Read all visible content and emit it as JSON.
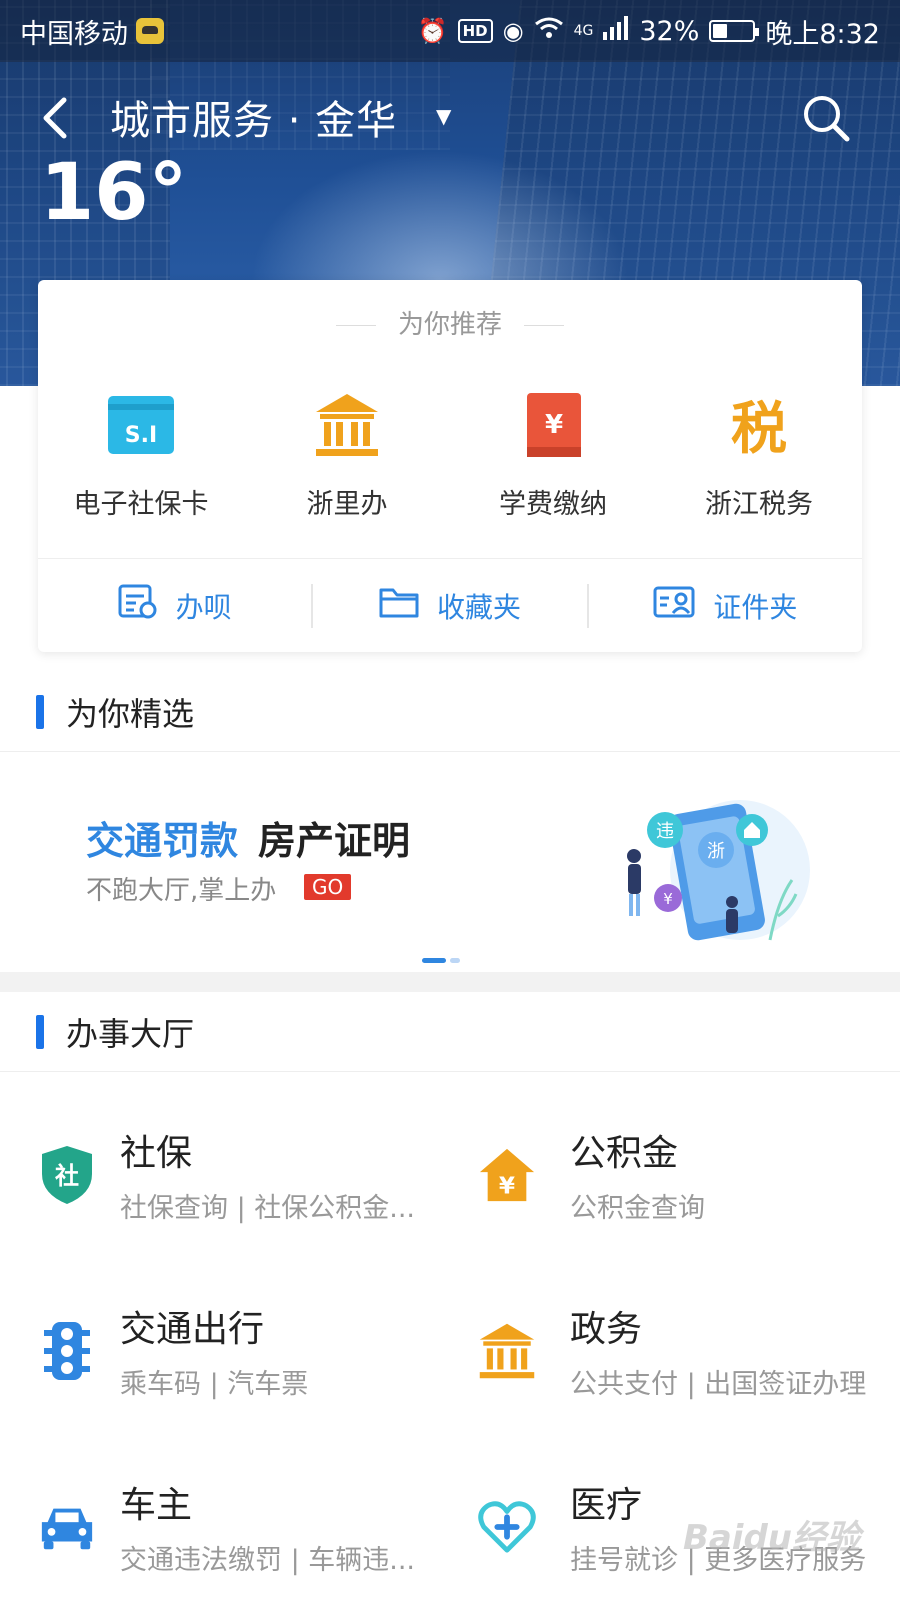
{
  "status_bar": {
    "carrier": "中国移动",
    "network": "4G",
    "battery": "32%",
    "time": "晚上8:32"
  },
  "header": {
    "title": "城市服务 · 金华",
    "temperature": "16°"
  },
  "recommend": {
    "heading": "为你推荐",
    "items": [
      {
        "label": "电子社保卡",
        "icon": "si-card-icon",
        "icon_text": "S.I"
      },
      {
        "label": "浙里办",
        "icon": "government-building-icon"
      },
      {
        "label": "学费缴纳",
        "icon": "tuition-book-icon",
        "icon_text": "¥"
      },
      {
        "label": "浙江税务",
        "icon": "tax-icon",
        "icon_text": "税"
      }
    ],
    "tools": [
      {
        "label": "办呗",
        "icon": "task-list-icon"
      },
      {
        "label": "收藏夹",
        "icon": "folder-icon"
      },
      {
        "label": "证件夹",
        "icon": "id-card-icon"
      }
    ]
  },
  "featured": {
    "heading": "为你精选",
    "banner": {
      "title_blue": "交通罚款",
      "title_dark": "房产证明",
      "subtitle": "不跑大厅,掌上办",
      "badge": "GO",
      "art_labels": [
        "违",
        "浙",
        "¥"
      ]
    }
  },
  "hall": {
    "heading": "办事大厅",
    "services": [
      {
        "title": "社保",
        "subtitle": "社保查询 | 社保公积金...",
        "icon": "social-security-shield-icon",
        "icon_text": "社"
      },
      {
        "title": "公积金",
        "subtitle": "公积金查询",
        "icon": "housing-fund-icon",
        "icon_text": "¥"
      },
      {
        "title": "交通出行",
        "subtitle": "乘车码 | 汽车票",
        "icon": "traffic-light-icon"
      },
      {
        "title": "政务",
        "subtitle": "公共支付 | 出国签证办理",
        "icon": "government-building-icon"
      },
      {
        "title": "车主",
        "subtitle": "交通违法缴罚 | 车辆违...",
        "icon": "car-icon"
      },
      {
        "title": "医疗",
        "subtitle": "挂号就诊 | 更多医疗服务",
        "icon": "medical-heart-icon"
      }
    ]
  },
  "watermark": "Baidu经验",
  "colors": {
    "accent": "#2f86e0",
    "orange": "#f0a21c",
    "red": "#e9553a",
    "green": "#23a58a",
    "badge_red": "#e23a2c"
  }
}
